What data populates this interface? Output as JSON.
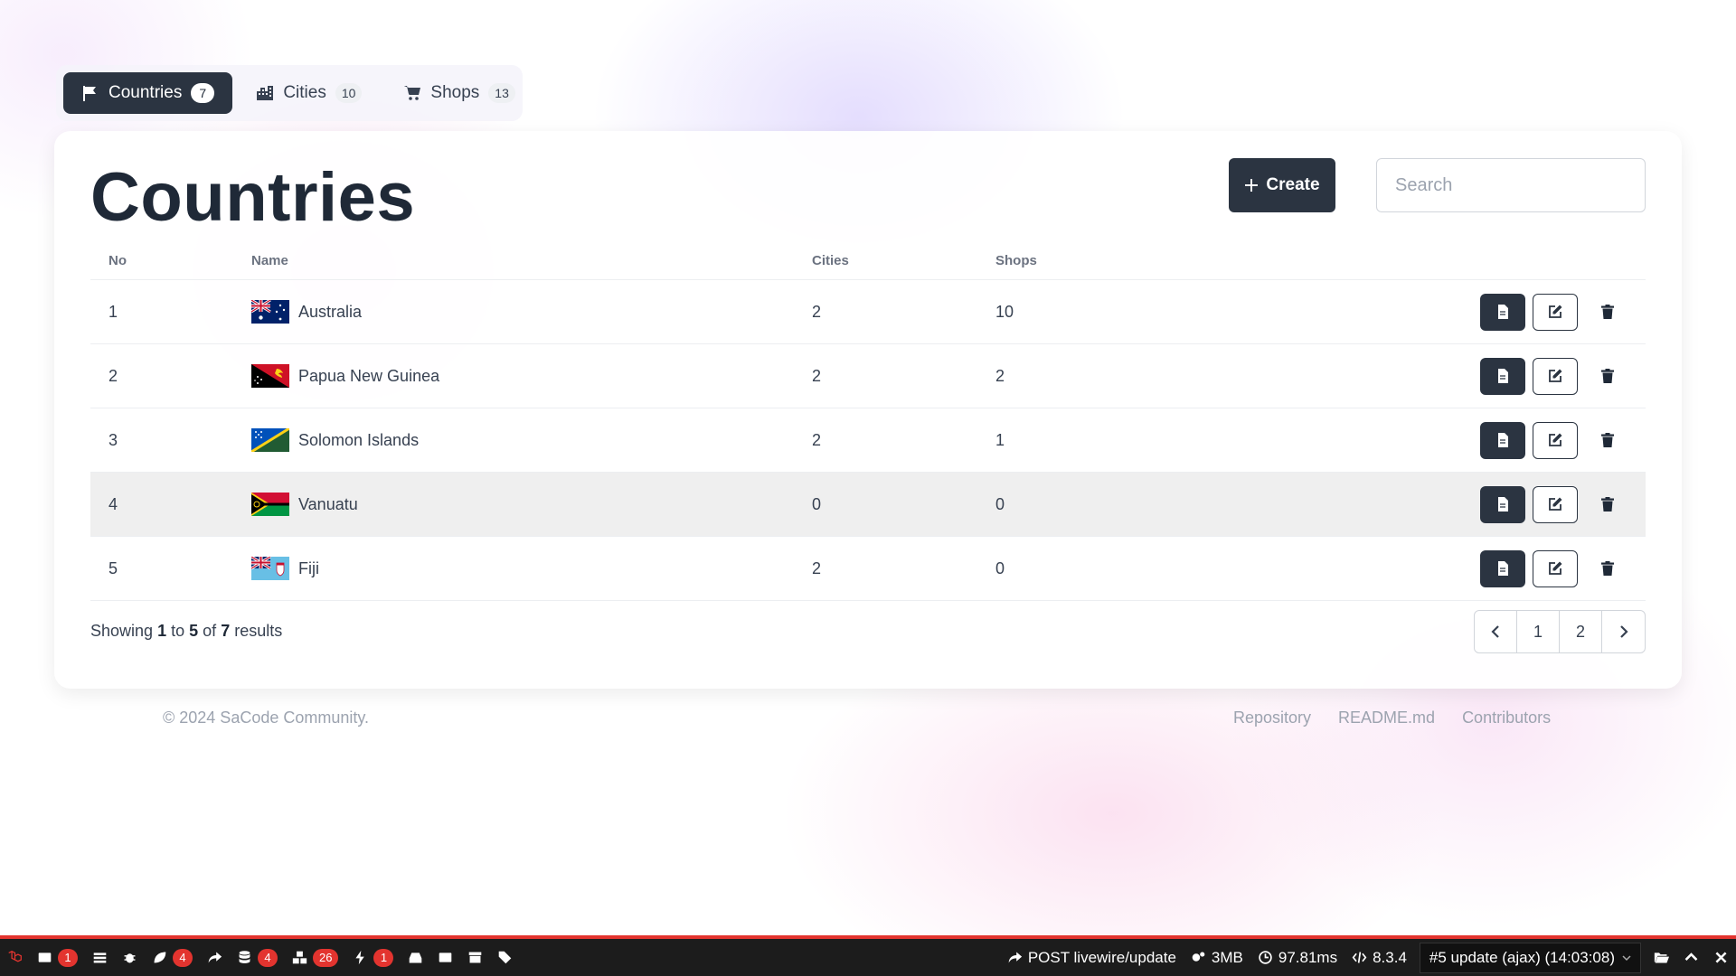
{
  "tabs": [
    {
      "label": "Countries",
      "count": "7",
      "icon": "flag-icon",
      "active": true
    },
    {
      "label": "Cities",
      "count": "10",
      "icon": "city-icon"
    },
    {
      "label": "Shops",
      "count": "13",
      "icon": "cart-icon"
    }
  ],
  "page": {
    "title": "Countries"
  },
  "toolbar": {
    "create_label": "Create",
    "search_placeholder": "Search",
    "search_value": ""
  },
  "table": {
    "headers": {
      "no": "No",
      "name": "Name",
      "cities": "Cities",
      "shops": "Shops"
    },
    "rows": [
      {
        "no": "1",
        "name": "Australia",
        "flag": "australia-flag",
        "cities": "2",
        "shops": "10"
      },
      {
        "no": "2",
        "name": "Papua New Guinea",
        "flag": "papua-new-guinea-flag",
        "cities": "2",
        "shops": "2"
      },
      {
        "no": "3",
        "name": "Solomon Islands",
        "flag": "solomon-islands-flag",
        "cities": "2",
        "shops": "1"
      },
      {
        "no": "4",
        "name": "Vanuatu",
        "flag": "vanuatu-flag",
        "cities": "0",
        "shops": "0",
        "highlighted": true
      },
      {
        "no": "5",
        "name": "Fiji",
        "flag": "fiji-flag",
        "cities": "2",
        "shops": "0"
      }
    ]
  },
  "pagination": {
    "showing_prefix": "Showing",
    "from": "1",
    "to_word": "to",
    "to": "5",
    "of_word": "of",
    "total": "7",
    "results_word": "results",
    "pages": [
      "1",
      "2"
    ]
  },
  "footer": {
    "copyright": "© 2024 SaCode Community.",
    "links": [
      "Repository",
      "README.md",
      "Contributors"
    ]
  },
  "debugbar": {
    "messages_count": "1",
    "exceptions_count": "4",
    "queries_count": "4",
    "models_count": "26",
    "livewire_count": "1",
    "request": "POST livewire/update",
    "memory": "3MB",
    "time": "97.81ms",
    "php_version": "8.3.4",
    "request_select": "#5 update (ajax) (14:03:08)"
  },
  "colors": {
    "primary": "#2b3441",
    "debug_accent": "#e3342f"
  }
}
